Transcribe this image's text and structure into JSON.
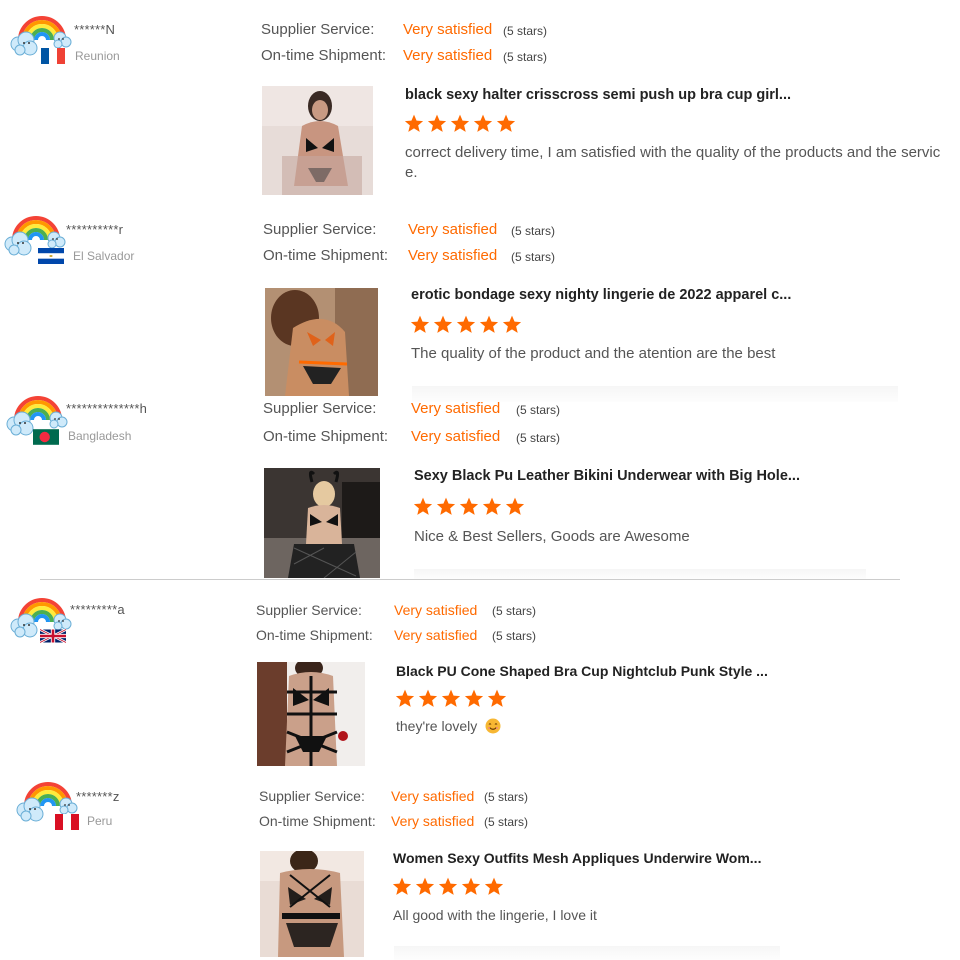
{
  "reviews": [
    {
      "username": "******N",
      "country": "Reunion",
      "flag": "fr",
      "supplier_label": "Supplier Service:",
      "supplier_value": "Very satisfied",
      "supplier_stars": "(5 stars)",
      "shipment_label": "On-time Shipment:",
      "shipment_value": "Very satisfied",
      "shipment_stars": "(5 stars)",
      "product_title": "black sexy halter crisscross semi push up bra cup girl...",
      "rating": 5,
      "comment_line1": "correct delivery time, I am satisfied with the quality of the products and the servic",
      "comment_line2": "e."
    },
    {
      "username": "**********r",
      "country": "El Salvador",
      "flag": "sv",
      "supplier_label": "Supplier Service:",
      "supplier_value": "Very satisfied",
      "supplier_stars": "(5 stars)",
      "shipment_label": "On-time Shipment:",
      "shipment_value": "Very satisfied",
      "shipment_stars": "(5 stars)",
      "product_title": "erotic bondage sexy nighty lingerie de 2022 apparel c...",
      "rating": 5,
      "comment_line1": "The quality of the product and the atention are the best"
    },
    {
      "username": "**************h",
      "country": "Bangladesh",
      "flag": "bd",
      "supplier_label": "Supplier Service:",
      "supplier_value": "Very satisfied",
      "supplier_stars": "(5 stars)",
      "shipment_label": "On-time Shipment:",
      "shipment_value": "Very satisfied",
      "shipment_stars": "(5 stars)",
      "product_title": "Sexy Black Pu Leather Bikini Underwear with Big Hole...",
      "rating": 5,
      "comment_line1": "Nice & Best Sellers,  Goods are Awesome"
    },
    {
      "username": "*********a",
      "country": "",
      "flag": "gb",
      "supplier_label": "Supplier Service:",
      "supplier_value": "Very satisfied",
      "supplier_stars": "(5 stars)",
      "shipment_label": "On-time Shipment:",
      "shipment_value": "Very satisfied",
      "shipment_stars": "(5 stars)",
      "product_title": "Black PU Cone Shaped Bra Cup Nightclub Punk Style ...",
      "rating": 5,
      "comment_line1": "they're lovely",
      "comment_emoji": "smiling-face-emoji"
    },
    {
      "username": "*******z",
      "country": "Peru",
      "flag": "pe",
      "supplier_label": "Supplier Service:",
      "supplier_value": "Very satisfied",
      "supplier_stars": "(5 stars)",
      "shipment_label": "On-time Shipment:",
      "shipment_value": "Very satisfied",
      "shipment_stars": "(5 stars)",
      "product_title": "Women Sexy Outfits Mesh Appliques Underwire Wom...",
      "rating": 5,
      "comment_line1": "All good with the lingerie, I love it"
    }
  ],
  "colors": {
    "accent": "#ff6a00",
    "star": "#ff6a00",
    "label": "#555555",
    "title": "#222222"
  },
  "icons": {
    "avatar": "rainbow-cloud-avatar",
    "rating": "star-icon"
  }
}
